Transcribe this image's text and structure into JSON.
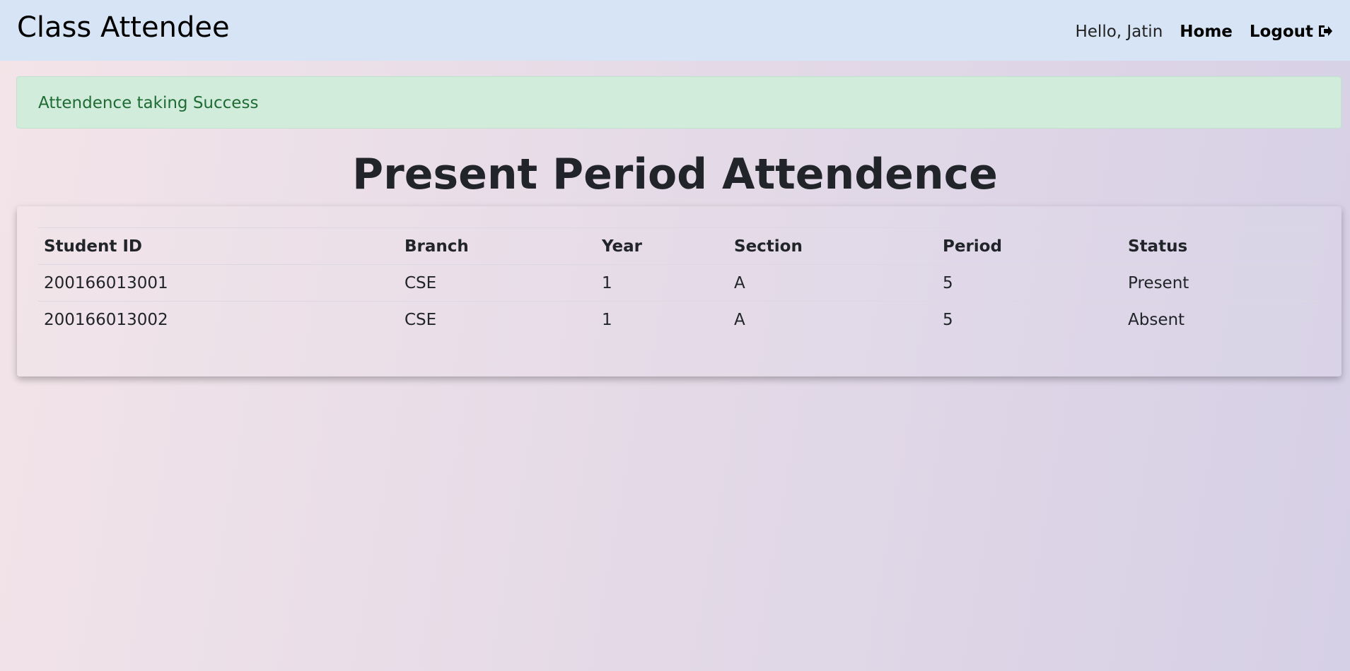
{
  "navbar": {
    "brand": "Class Attendee",
    "greeting": "Hello, Jatin",
    "home_label": "Home",
    "logout_label": "Logout"
  },
  "alert": {
    "message": "Attendence taking Success",
    "color": "#1e6b33"
  },
  "page": {
    "title": "Present Period Attendence"
  },
  "table": {
    "headers": [
      "Student ID",
      "Branch",
      "Year",
      "Section",
      "Period",
      "Status"
    ],
    "rows": [
      [
        "200166013001",
        "CSE",
        "1",
        "A",
        "5",
        "Present"
      ],
      [
        "200166013002",
        "CSE",
        "1",
        "A",
        "5",
        "Absent"
      ]
    ]
  },
  "icons": {
    "logout": "logout-icon"
  }
}
